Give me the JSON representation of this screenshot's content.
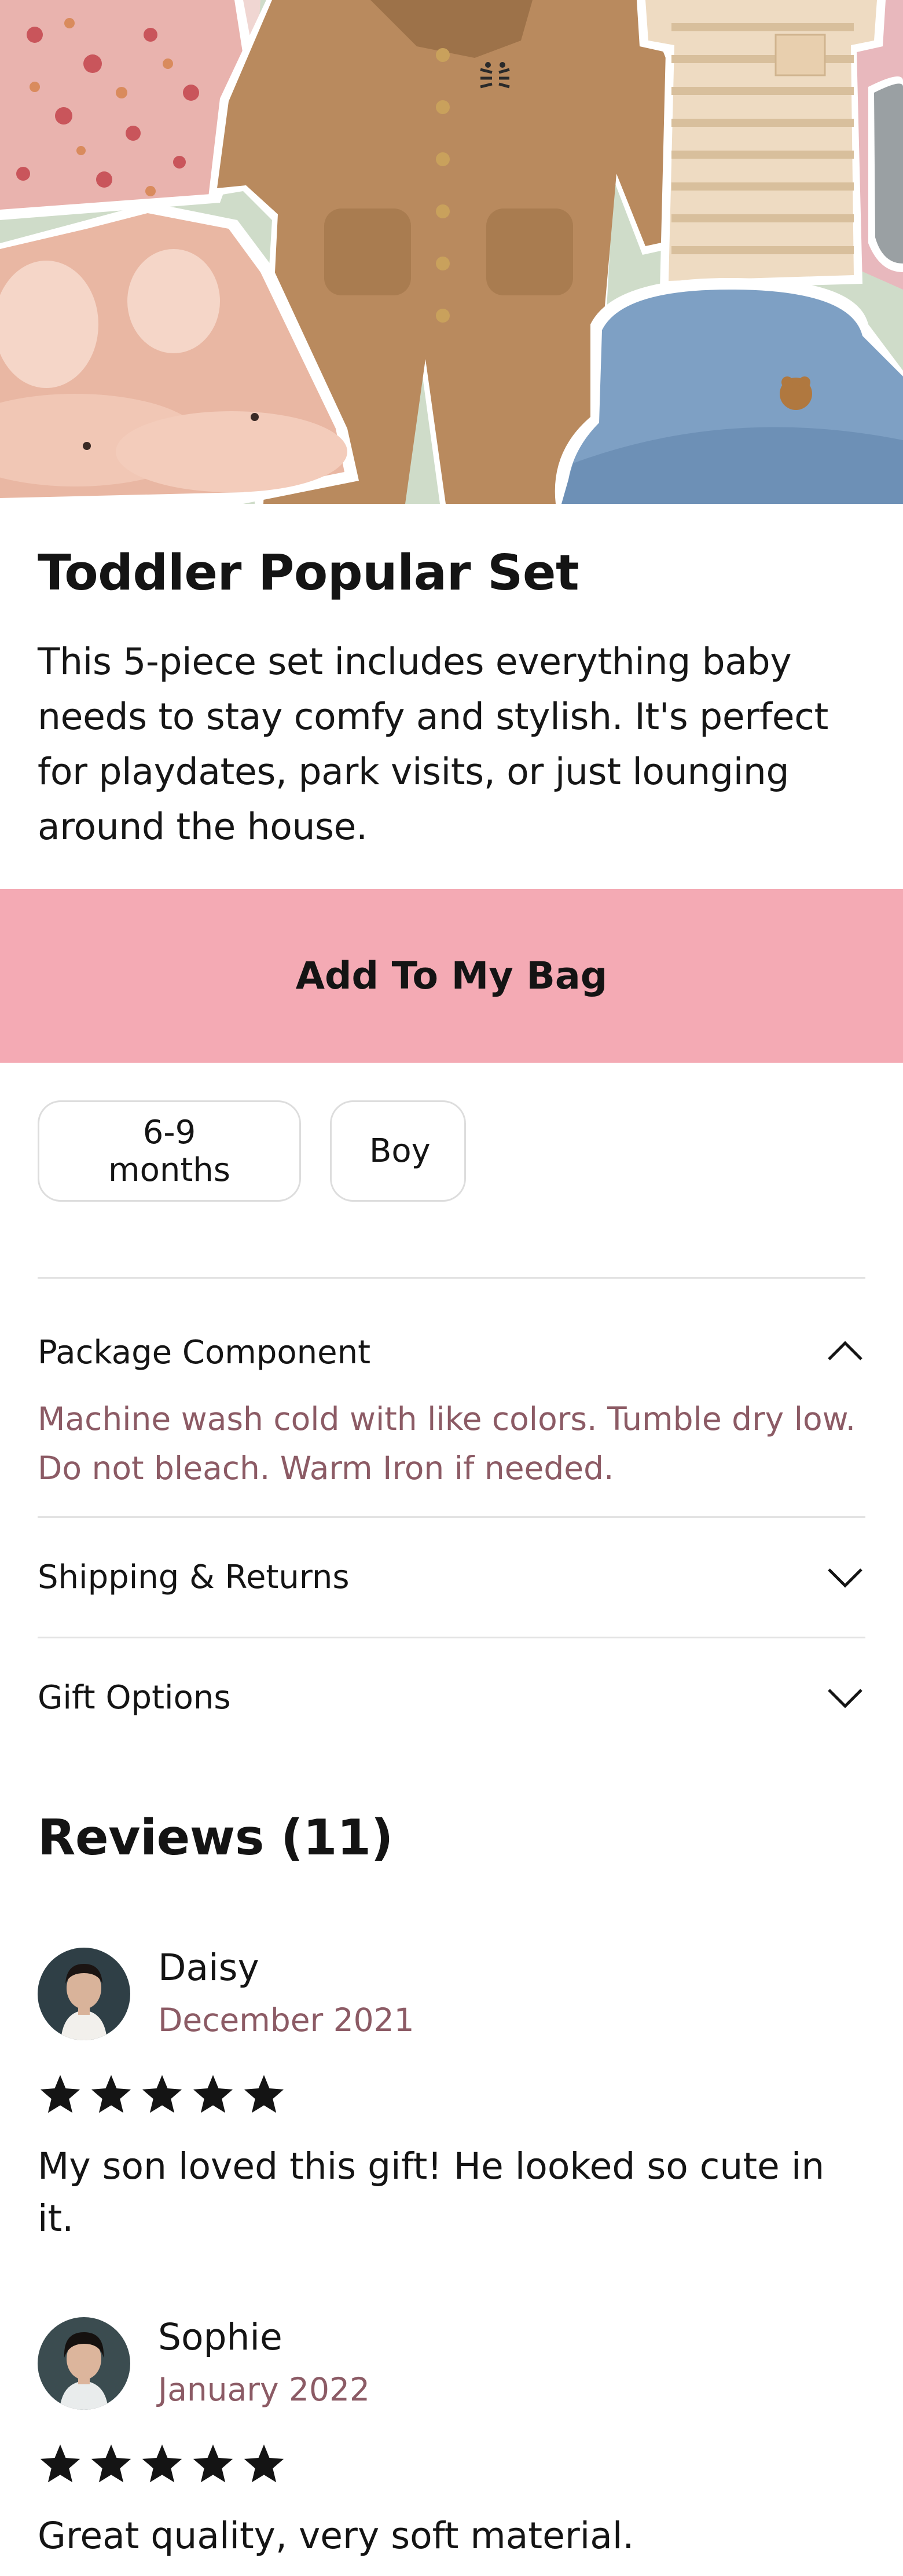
{
  "product": {
    "title": "Toddler Popular Set",
    "description": "This 5-piece set includes everything baby needs to stay comfy and stylish. It's perfect for playdates, park visits, or just lounging around the house."
  },
  "actions": {
    "add_to_bag_label": "Add To My Bag"
  },
  "options": {
    "size": "6-9 months",
    "gender": "Boy"
  },
  "accordion": {
    "package_component": {
      "title": "Package Component",
      "body": "Machine wash cold with like colors. Tumble dry low. Do not bleach. Warm Iron if needed.",
      "expanded": true
    },
    "shipping": {
      "title": "Shipping & Returns",
      "expanded": false
    },
    "gift": {
      "title": "Gift Options",
      "expanded": false
    }
  },
  "reviews": {
    "heading": "Reviews (11)",
    "items": [
      {
        "name": "Daisy",
        "date": "December 2021",
        "rating": 5,
        "text": "My son loved this gift! He looked so cute in it."
      },
      {
        "name": "Sophie",
        "date": "January 2022",
        "rating": 5,
        "text": "Great quality, very soft material."
      }
    ]
  },
  "icons": {
    "hero": "product-collage-image",
    "chevron_up": "chevron-up-icon",
    "chevron_down": "chevron-down-icon",
    "star": "star-icon"
  },
  "colors": {
    "accent_pink": "#f4aab4",
    "muted_text": "#8c5b65",
    "border": "#dddddd"
  }
}
